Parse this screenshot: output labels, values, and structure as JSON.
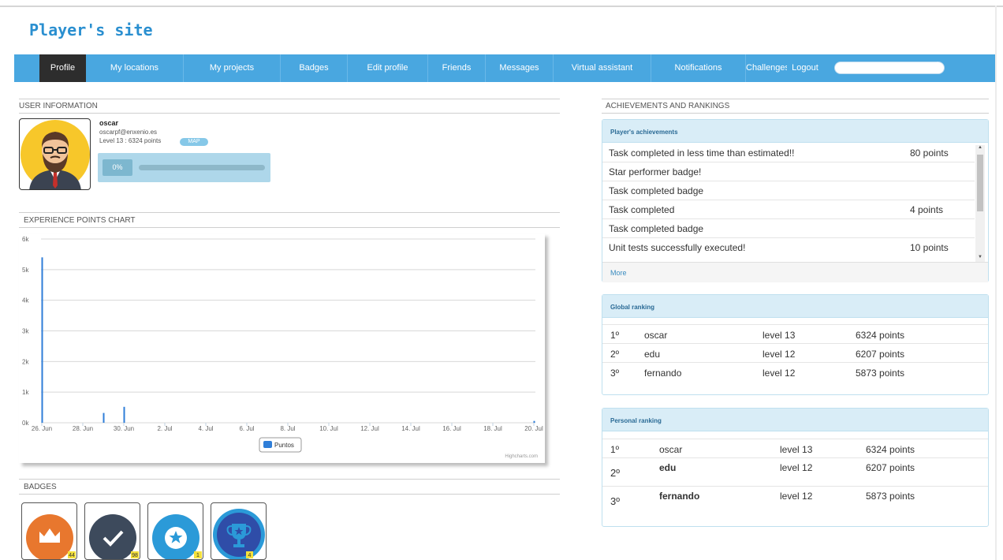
{
  "site": {
    "title": "Player's site"
  },
  "nav": {
    "items": [
      {
        "label": "Profile",
        "active": true
      },
      {
        "label": "My locations"
      },
      {
        "label": "My projects"
      },
      {
        "label": "Badges"
      },
      {
        "label": "Edit profile"
      },
      {
        "label": "Friends"
      },
      {
        "label": "Messages"
      },
      {
        "label": "Virtual assistant"
      },
      {
        "label": "Notifications"
      },
      {
        "label": "Challenges"
      },
      {
        "label": "Logout"
      }
    ],
    "search": {
      "value": "",
      "placeholder": "",
      "icon": "lock-icon"
    }
  },
  "user_info": {
    "heading": "USER INFORMATION",
    "name": "oscar",
    "email": "oscarpf@enxenio.es",
    "level": "Level 13 : 6324 points",
    "map_label": "MAP",
    "progress_label": "0%",
    "progress_fraction": 0
  },
  "xp_chart": {
    "heading": "EXPERIENCE POINTS CHART",
    "credit": "Highcharts.com"
  },
  "chart_data": {
    "type": "bar",
    "title": "",
    "xlabel": "",
    "ylabel": "",
    "ylim": [
      0,
      6000
    ],
    "yticks": [
      "0k",
      "1k",
      "2k",
      "3k",
      "4k",
      "5k",
      "6k"
    ],
    "xticks": [
      "26. Jun",
      "28. Jun",
      "30. Jun",
      "2. Jul",
      "4. Jul",
      "6. Jul",
      "8. Jul",
      "10. Jul",
      "12. Jul",
      "14. Jul",
      "16. Jul",
      "18. Jul",
      "20. Jul"
    ],
    "x": [
      "26. Jun",
      "29. Jun",
      "30. Jun",
      "20. Jul"
    ],
    "series": [
      {
        "name": "Puntos",
        "color": "#2f7ed8",
        "values": [
          5400,
          320,
          520,
          60
        ]
      }
    ],
    "grid": true,
    "legend": "bottom-center"
  },
  "badges": {
    "heading": "BADGES",
    "items": [
      {
        "icon": "crown-icon",
        "count": "44",
        "color": "#e8772e"
      },
      {
        "icon": "checkmark-icon",
        "count": "98",
        "color": "#3d4a5c"
      },
      {
        "icon": "star-icon",
        "count": "1",
        "color": "#2b9ad8"
      },
      {
        "icon": "trophy-icon",
        "count": "4",
        "color": "#2f4da8"
      }
    ]
  },
  "achievements": {
    "heading": "ACHIEVEMENTS AND RANKINGS",
    "panel_title": "Player's achievements",
    "rows": [
      {
        "text": "Task completed in less time than estimated!!",
        "points": "80 points"
      },
      {
        "text": "Star performer badge!",
        "points": ""
      },
      {
        "text": "Task completed badge",
        "points": ""
      },
      {
        "text": "Task completed",
        "points": "4 points"
      },
      {
        "text": "Task completed badge",
        "points": ""
      },
      {
        "text": "Unit tests successfully executed!",
        "points": "10 points"
      }
    ],
    "more": "More"
  },
  "global_ranking": {
    "title": "Global ranking",
    "rows": [
      {
        "pos": "1º",
        "name": "oscar",
        "level": "level 13",
        "points": "6324 points"
      },
      {
        "pos": "2º",
        "name": "edu",
        "level": "level 12",
        "points": "6207 points"
      },
      {
        "pos": "3º",
        "name": "fernando",
        "level": "level 12",
        "points": "5873 points"
      }
    ]
  },
  "personal_ranking": {
    "title": "Personal ranking",
    "rows": [
      {
        "pos": "1º",
        "name": "oscar",
        "level": "level 13",
        "points": "6324 points"
      },
      {
        "pos": "2º",
        "name": "edu",
        "level": "level 12",
        "points": "6207 points"
      },
      {
        "pos": "3º",
        "name": "fernando",
        "level": "level 12",
        "points": "5873 points"
      }
    ]
  }
}
